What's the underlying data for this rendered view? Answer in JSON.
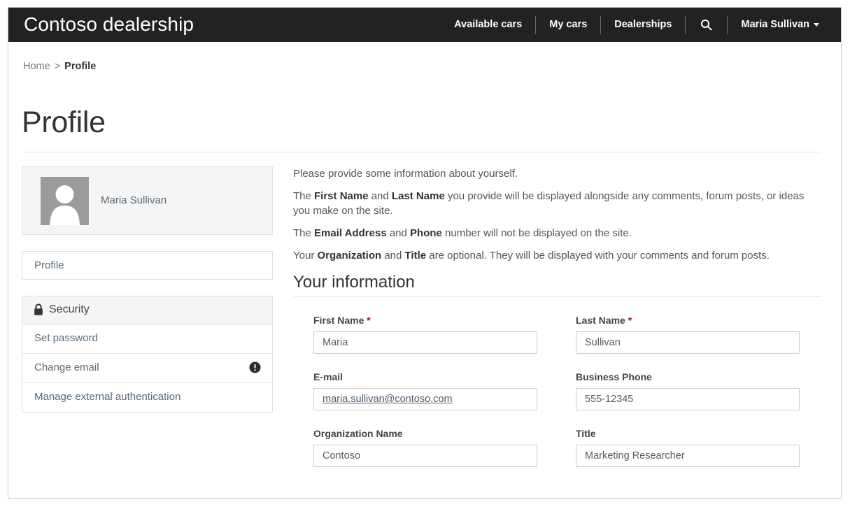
{
  "navbar": {
    "brand": "Contoso dealership",
    "links": [
      {
        "label": "Available cars"
      },
      {
        "label": "My cars"
      },
      {
        "label": "Dealerships"
      }
    ],
    "search_icon": "search-icon",
    "user": "Maria Sullivan",
    "background_color": "#222222"
  },
  "breadcrumb": {
    "home": "Home",
    "separator": ">",
    "current": "Profile"
  },
  "page": {
    "title": "Profile"
  },
  "sidebar": {
    "profile_card": {
      "name": "Maria Sullivan",
      "avatar_icon": "user-avatar-icon",
      "avatar_color": "#9b9b9b"
    },
    "profile_link": {
      "label": "Profile"
    },
    "security": {
      "header_label": "Security",
      "header_icon": "lock-icon",
      "items": [
        {
          "label": "Set password",
          "icon": ""
        },
        {
          "label": "Change email",
          "icon": "exclamation-circle-icon"
        },
        {
          "label": "Manage external authentication",
          "icon": ""
        }
      ]
    }
  },
  "main": {
    "intro": [
      {
        "id": "p1",
        "text": "Please provide some information about yourself."
      },
      {
        "id": "p2",
        "text": "The First Name and Last Name you provide will be displayed alongside any comments, forum posts, or ideas you make on the site."
      },
      {
        "id": "p3",
        "text": "The Email Address and Phone number will not be displayed on the site."
      },
      {
        "id": "p4",
        "text": "Your Organization and Title are optional. They will be displayed with your comments and forum posts."
      }
    ],
    "intro_parts": {
      "p2_a": "The ",
      "p2_b1": "First Name",
      "p2_b": " and ",
      "p2_b2": "Last Name",
      "p2_c": " you provide will be displayed alongside any comments, forum posts, or ideas you make on the site.",
      "p3_a": "The ",
      "p3_b1": "Email Address",
      "p3_b": " and ",
      "p3_b2": "Phone",
      "p3_c": " number will not be displayed on the site.",
      "p4_a": "Your ",
      "p4_b1": "Organization",
      "p4_b": " and ",
      "p4_b2": "Title",
      "p4_c": " are optional. They will be displayed with your comments and forum posts."
    },
    "section_heading": "Your information",
    "required_marker": "*",
    "fields": {
      "first_name": {
        "label": "First Name",
        "required": true,
        "value": "Maria"
      },
      "last_name": {
        "label": "Last Name",
        "required": true,
        "value": "Sullivan"
      },
      "email": {
        "label": "E-mail",
        "required": false,
        "value": "maria.sullivan@contoso.com"
      },
      "phone": {
        "label": "Business Phone",
        "required": false,
        "value": "555-12345"
      },
      "organization": {
        "label": "Organization Name",
        "required": false,
        "value": "Contoso"
      },
      "title": {
        "label": "Title",
        "required": false,
        "value": "Marketing Researcher"
      }
    }
  }
}
